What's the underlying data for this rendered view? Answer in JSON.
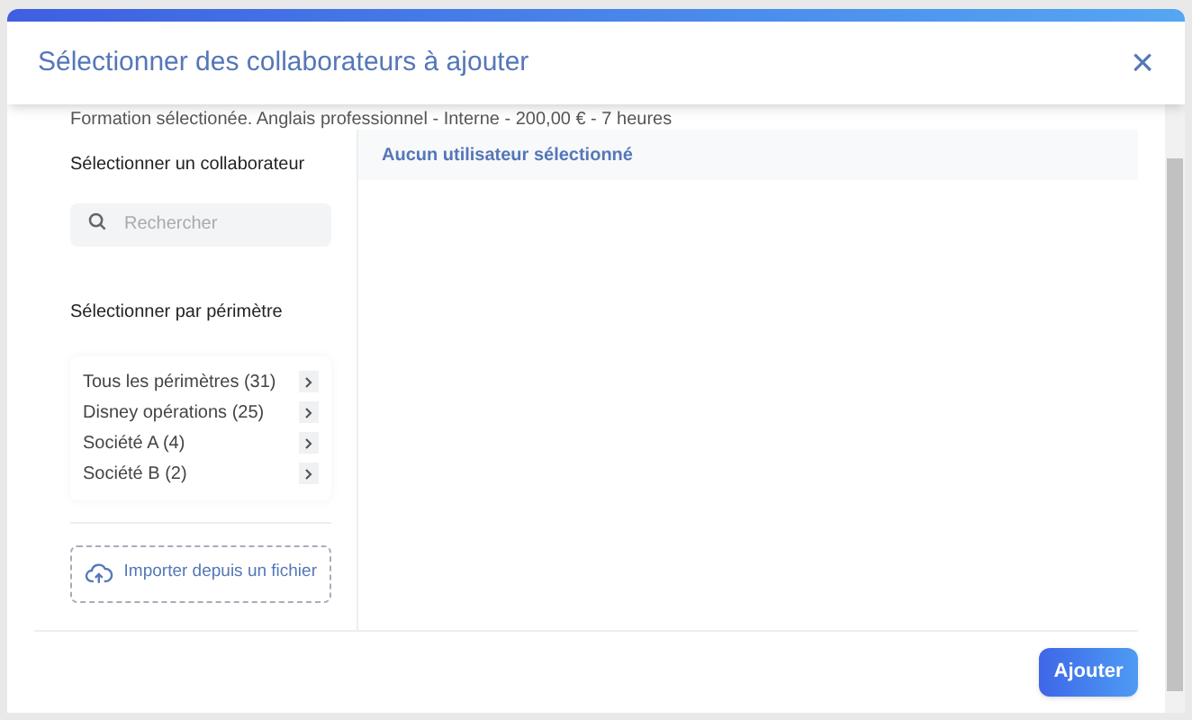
{
  "dialog": {
    "title": "Sélectionner des collaborateurs à ajouter",
    "close": "×"
  },
  "training_info": "Formation sélectionée. Anglais professionnel - Interne - 200,00 € - 7 heures",
  "left": {
    "collaborator_heading": "Sélectionner un collaborateur",
    "search": {
      "placeholder": "Rechercher"
    },
    "scope_heading": "Sélectionner par périmètre",
    "scopes": [
      {
        "label": "Tous les périmètres (31)"
      },
      {
        "label": "Disney opérations (25)"
      },
      {
        "label": "Société A (4)"
      },
      {
        "label": "Société B (2)"
      }
    ],
    "import_button": "Importer depuis un fichier"
  },
  "right": {
    "empty_message": "Aucun utilisateur sélectionné"
  },
  "footer": {
    "add_button": "Ajouter"
  }
}
